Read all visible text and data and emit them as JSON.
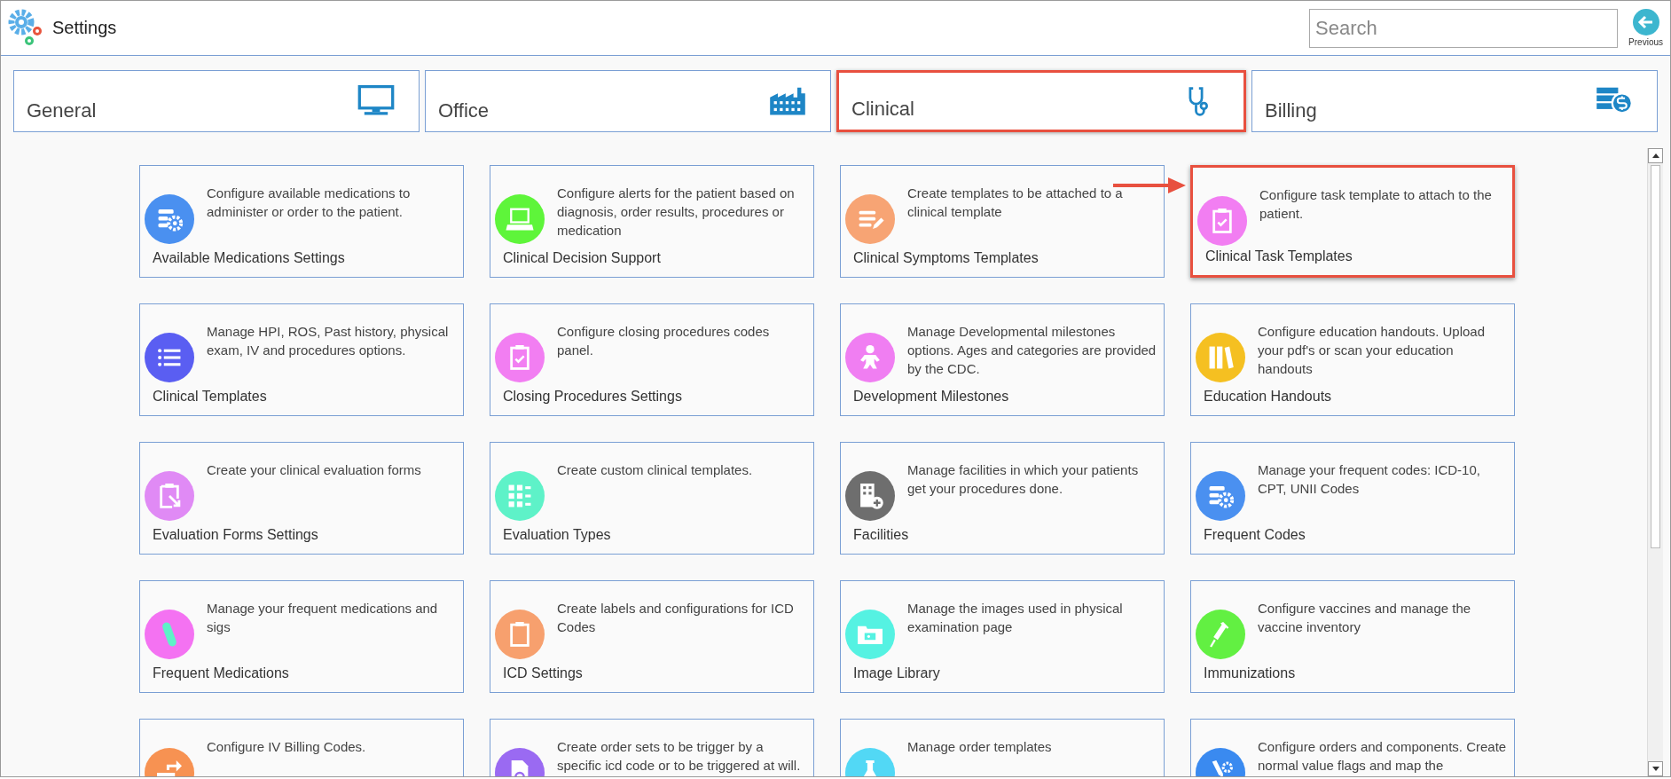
{
  "window": {
    "title": "Settings"
  },
  "search": {
    "placeholder": "Search"
  },
  "previous_button": {
    "label": "Previous"
  },
  "tabs": [
    {
      "label": "General",
      "highlighted": false
    },
    {
      "label": "Office",
      "highlighted": false
    },
    {
      "label": "Clinical",
      "highlighted": true
    },
    {
      "label": "Billing",
      "highlighted": false
    }
  ],
  "cards": [
    {
      "title": "Available Medications Settings",
      "description": "Configure available medications to administer or order to the patient.",
      "color": "#4a90f0",
      "highlighted": false
    },
    {
      "title": "Clinical Decision Support",
      "description": "Configure alerts for the patient based on diagnosis, order results, procedures or medication",
      "color": "#5ef53a",
      "highlighted": false
    },
    {
      "title": "Clinical Symptoms Templates",
      "description": "Create templates to be attached to a clinical template",
      "color": "#f7a474",
      "highlighted": false
    },
    {
      "title": "Clinical Task Templates",
      "description": "Configure task template to attach to the patient.",
      "color": "#f27ef2",
      "highlighted": true
    },
    {
      "title": "Clinical Templates",
      "description": "Manage HPI, ROS, Past history, physical exam, IV and procedures options.",
      "color": "#5a5ef2",
      "highlighted": false
    },
    {
      "title": "Closing Procedures Settings",
      "description": "Configure closing procedures codes panel.",
      "color": "#f27ef2",
      "highlighted": false
    },
    {
      "title": "Development Milestones",
      "description": "Manage Developmental milestones options. Ages and categories are provided by the CDC.",
      "color": "#f07ef2",
      "highlighted": false
    },
    {
      "title": "Education Handouts",
      "description": "Configure education handouts. Upload your pdf's or scan your education handouts",
      "color": "#f5c021",
      "highlighted": false
    },
    {
      "title": "Evaluation Forms Settings",
      "description": "Create your clinical evaluation forms",
      "color": "#e08af5",
      "highlighted": false
    },
    {
      "title": "Evaluation Types",
      "description": "Create custom clinical templates.",
      "color": "#5ef2c8",
      "highlighted": false
    },
    {
      "title": "Facilities",
      "description": "Manage facilities in which your patients get your procedures done.",
      "color": "#6e6e6e",
      "highlighted": false
    },
    {
      "title": "Frequent Codes",
      "description": "Manage your frequent codes: ICD-10, CPT, UNII Codes",
      "color": "#4a90f0",
      "highlighted": false
    },
    {
      "title": "Frequent Medications",
      "description": "Manage your frequent medications and sigs",
      "color": "#f472f2",
      "highlighted": false
    },
    {
      "title": "ICD Settings",
      "description": "Create labels and configurations for ICD Codes",
      "color": "#f7a06e",
      "highlighted": false
    },
    {
      "title": "Image Library",
      "description": "Manage the images used in physical examination page",
      "color": "#55f2e2",
      "highlighted": false
    },
    {
      "title": "Immunizations",
      "description": "Configure vaccines and manage the vaccine inventory",
      "color": "#62f042",
      "highlighted": false
    },
    {
      "description": "Configure IV Billing Codes.",
      "color": "#f79252",
      "highlighted": false
    },
    {
      "description": "Create order sets to be trigger by a specific icd code or to be triggered at will.",
      "color": "#9a6af2",
      "highlighted": false
    },
    {
      "description": "Manage order templates",
      "color": "#52d8f5",
      "highlighted": false
    },
    {
      "description": "Configure orders and components. Create normal value flags and map the",
      "color": "#3a8af0",
      "highlighted": false
    }
  ]
}
